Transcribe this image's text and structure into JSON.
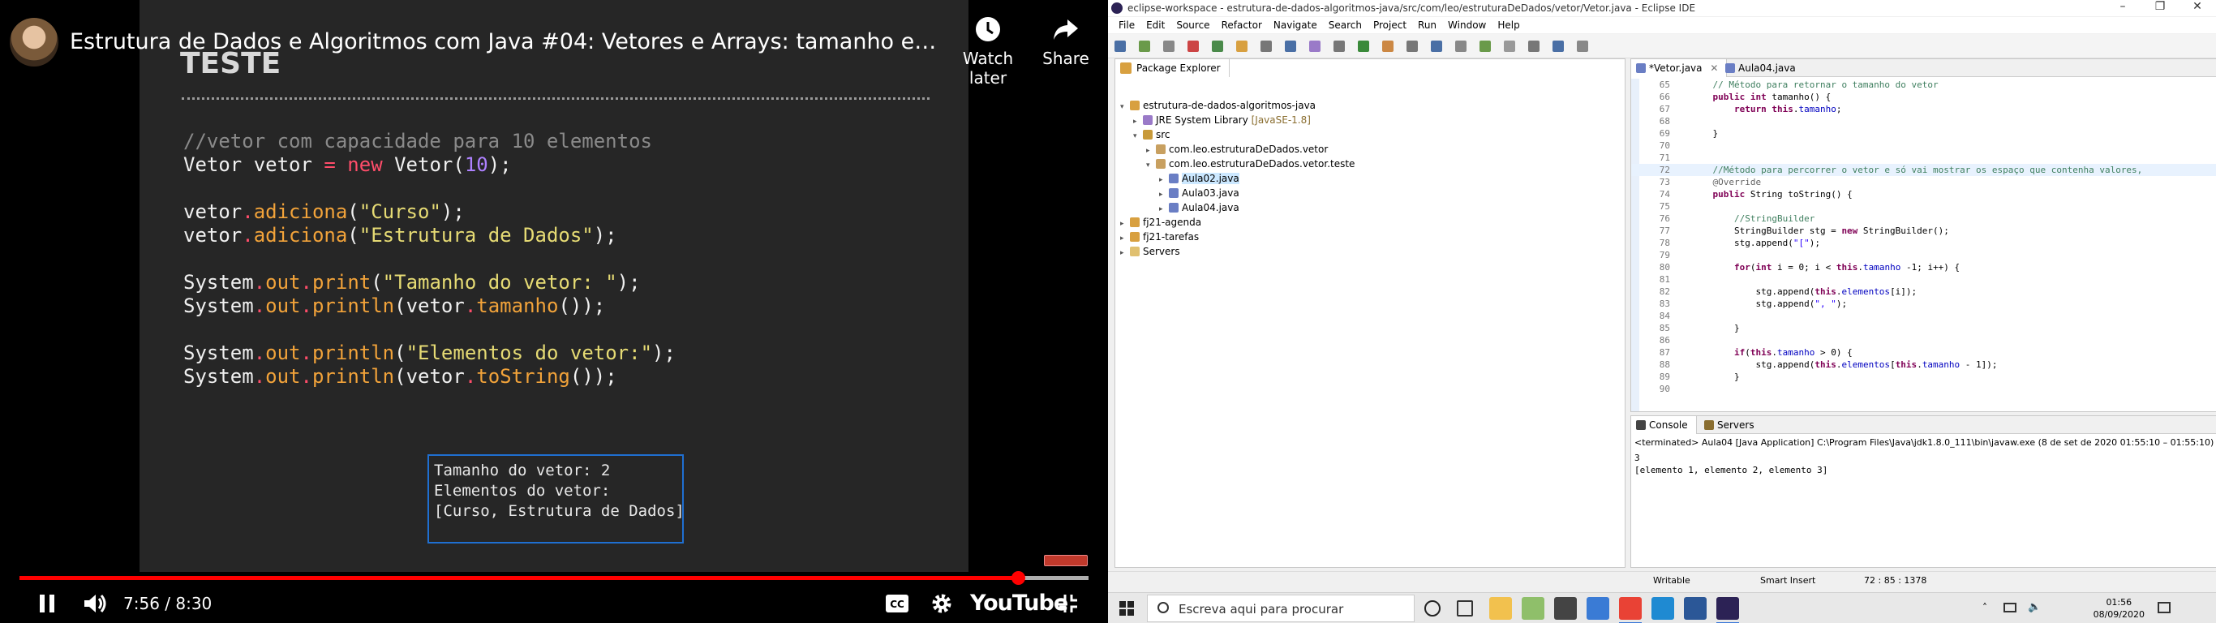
{
  "youtube": {
    "video_title": "Estrutura de Dados e Algoritmos com Java #04: Vetores e Arrays: tamanho e imprimir el…",
    "watch_later_label": "Watch later",
    "share_label": "Share",
    "slide": {
      "title": "TESTE",
      "code_lines": [
        [
          {
            "t": "//vetor com capacidade para 10 elementos",
            "c": "c-com"
          }
        ],
        [
          {
            "t": "Vetor vetor "
          },
          {
            "t": "=",
            "c": "c-op"
          },
          {
            "t": " "
          },
          {
            "t": "new",
            "c": "c-kw"
          },
          {
            "t": " Vetor("
          },
          {
            "t": "10",
            "c": "c-num"
          },
          {
            "t": ");"
          }
        ],
        [
          {
            "t": ""
          }
        ],
        [
          {
            "t": "vetor"
          },
          {
            "t": ".",
            "c": "c-op"
          },
          {
            "t": "adiciona",
            "c": "c-fn"
          },
          {
            "t": "("
          },
          {
            "t": "\"Curso\"",
            "c": "c-str"
          },
          {
            "t": ");"
          }
        ],
        [
          {
            "t": "vetor"
          },
          {
            "t": ".",
            "c": "c-op"
          },
          {
            "t": "adiciona",
            "c": "c-fn"
          },
          {
            "t": "("
          },
          {
            "t": "\"Estrutura de Dados\"",
            "c": "c-str"
          },
          {
            "t": ");"
          }
        ],
        [
          {
            "t": ""
          }
        ],
        [
          {
            "t": "System"
          },
          {
            "t": ".",
            "c": "c-op"
          },
          {
            "t": "out",
            "c": "c-fn"
          },
          {
            "t": ".",
            "c": "c-op"
          },
          {
            "t": "print",
            "c": "c-fn"
          },
          {
            "t": "("
          },
          {
            "t": "\"Tamanho do vetor: \"",
            "c": "c-str"
          },
          {
            "t": ");"
          }
        ],
        [
          {
            "t": "System"
          },
          {
            "t": ".",
            "c": "c-op"
          },
          {
            "t": "out",
            "c": "c-fn"
          },
          {
            "t": ".",
            "c": "c-op"
          },
          {
            "t": "println",
            "c": "c-fn"
          },
          {
            "t": "(vetor"
          },
          {
            "t": ".",
            "c": "c-op"
          },
          {
            "t": "tamanho",
            "c": "c-fn"
          },
          {
            "t": "());"
          }
        ],
        [
          {
            "t": ""
          }
        ],
        [
          {
            "t": "System"
          },
          {
            "t": ".",
            "c": "c-op"
          },
          {
            "t": "out",
            "c": "c-fn"
          },
          {
            "t": ".",
            "c": "c-op"
          },
          {
            "t": "println",
            "c": "c-fn"
          },
          {
            "t": "("
          },
          {
            "t": "\"Elementos do vetor:\"",
            "c": "c-str"
          },
          {
            "t": ");"
          }
        ],
        [
          {
            "t": "System"
          },
          {
            "t": ".",
            "c": "c-op"
          },
          {
            "t": "out",
            "c": "c-fn"
          },
          {
            "t": ".",
            "c": "c-op"
          },
          {
            "t": "println",
            "c": "c-fn"
          },
          {
            "t": "(vetor"
          },
          {
            "t": ".",
            "c": "c-op"
          },
          {
            "t": "toString",
            "c": "c-fn"
          },
          {
            "t": "());"
          }
        ]
      ],
      "output_lines": [
        "Tamanho do vetor: 2",
        "Elementos do vetor:",
        "[Curso, Estrutura de Dados]"
      ]
    },
    "time_current": "7:56",
    "time_total": "8:30",
    "time_display": "7:56 / 8:30",
    "progress_fraction": 0.934,
    "buffered_fraction": 1.0,
    "logo_text": "YouTube",
    "colors": {
      "progress": "#ff0000",
      "slide_bg": "#262626",
      "output_border": "#1f6fd1"
    }
  },
  "eclipse": {
    "window_title": "eclipse-workspace - estrutura-de-dados-algoritmos-java/src/com/leo/estruturaDeDados/vetor/Vetor.java - Eclipse IDE",
    "menu": [
      "File",
      "Edit",
      "Source",
      "Refactor",
      "Navigate",
      "Search",
      "Project",
      "Run",
      "Window",
      "Help"
    ],
    "package_explorer": {
      "tab_label": "Package Explorer",
      "tree": [
        {
          "label": "estrutura-de-dados-algoritmos-java",
          "depth": 0,
          "arrow": "▾",
          "icon": "project-icon",
          "color": "#d8a040"
        },
        {
          "label": "JRE System Library",
          "decor": " [JavaSE-1.8]",
          "depth": 1,
          "arrow": "▸",
          "icon": "library-icon",
          "color": "#9a7ac8"
        },
        {
          "label": "src",
          "depth": 1,
          "arrow": "▾",
          "icon": "source-folder-icon",
          "color": "#c89a3a"
        },
        {
          "label": "com.leo.estruturaDeDados.vetor",
          "depth": 2,
          "arrow": "▸",
          "icon": "package-icon",
          "color": "#c8a060"
        },
        {
          "label": "com.leo.estruturaDeDados.vetor.teste",
          "depth": 2,
          "arrow": "▾",
          "icon": "package-icon",
          "color": "#c8a060"
        },
        {
          "label": "Aula02.java",
          "depth": 3,
          "arrow": "▸",
          "icon": "java-file-icon",
          "color": "#6a7ec4",
          "selected": true
        },
        {
          "label": "Aula03.java",
          "depth": 3,
          "arrow": "▸",
          "icon": "java-file-icon",
          "color": "#6a7ec4"
        },
        {
          "label": "Aula04.java",
          "depth": 3,
          "arrow": "▸",
          "icon": "java-file-icon",
          "color": "#6a7ec4"
        },
        {
          "label": "fj21-agenda",
          "depth": 0,
          "arrow": "▸",
          "icon": "project-icon",
          "color": "#d8a040"
        },
        {
          "label": "fj21-tarefas",
          "depth": 0,
          "arrow": "▸",
          "icon": "project-icon",
          "color": "#d8a040"
        },
        {
          "label": "Servers",
          "depth": 0,
          "arrow": "▸",
          "icon": "folder-icon",
          "color": "#e0c070"
        }
      ]
    },
    "editor": {
      "tabs": [
        {
          "label": "*Vetor.java"
        },
        {
          "label": "Aula04.java"
        }
      ],
      "lines": [
        {
          "no": "65",
          "segs": [
            {
              "t": "    "
            },
            {
              "t": "// Método para retornar o tamanho do vetor",
              "c": "e-com"
            }
          ]
        },
        {
          "no": "66",
          "segs": [
            {
              "t": "    "
            },
            {
              "t": "public int",
              "c": "e-kw"
            },
            {
              "t": " tamanho() {"
            }
          ]
        },
        {
          "no": "67",
          "segs": [
            {
              "t": "        "
            },
            {
              "t": "return this",
              "c": "e-kw"
            },
            {
              "t": "."
            },
            {
              "t": "tamanho",
              "c": "e-fld"
            },
            {
              "t": ";"
            }
          ]
        },
        {
          "no": "68",
          "segs": [
            {
              "t": ""
            }
          ]
        },
        {
          "no": "69",
          "segs": [
            {
              "t": "    }"
            }
          ]
        },
        {
          "no": "70",
          "segs": [
            {
              "t": ""
            }
          ]
        },
        {
          "no": "71",
          "segs": [
            {
              "t": ""
            }
          ]
        },
        {
          "no": "72",
          "hl": true,
          "segs": [
            {
              "t": "    "
            },
            {
              "t": "//Método para percorrer o vetor e só vai mostrar os espaço que contenha valores,",
              "c": "e-com"
            }
          ]
        },
        {
          "no": "73",
          "segs": [
            {
              "t": "    "
            },
            {
              "t": "@Override",
              "c": "e-ann"
            }
          ]
        },
        {
          "no": "74",
          "segs": [
            {
              "t": "    "
            },
            {
              "t": "public",
              "c": "e-kw"
            },
            {
              "t": " String toString() {"
            }
          ]
        },
        {
          "no": "75",
          "segs": [
            {
              "t": ""
            }
          ]
        },
        {
          "no": "76",
          "segs": [
            {
              "t": "        "
            },
            {
              "t": "//StringBuilder",
              "c": "e-com"
            }
          ]
        },
        {
          "no": "77",
          "segs": [
            {
              "t": "        StringBuilder stg = "
            },
            {
              "t": "new",
              "c": "e-kw"
            },
            {
              "t": " StringBuilder();"
            }
          ]
        },
        {
          "no": "78",
          "segs": [
            {
              "t": "        stg.append("
            },
            {
              "t": "\"[\"",
              "c": "e-str"
            },
            {
              "t": ");"
            }
          ]
        },
        {
          "no": "79",
          "segs": [
            {
              "t": ""
            }
          ]
        },
        {
          "no": "80",
          "segs": [
            {
              "t": "        "
            },
            {
              "t": "for",
              "c": "e-kw"
            },
            {
              "t": "("
            },
            {
              "t": "int",
              "c": "e-kw"
            },
            {
              "t": " i = 0; i < "
            },
            {
              "t": "this",
              "c": "e-kw"
            },
            {
              "t": "."
            },
            {
              "t": "tamanho",
              "c": "e-fld"
            },
            {
              "t": " -1; i++) {"
            }
          ]
        },
        {
          "no": "81",
          "segs": [
            {
              "t": ""
            }
          ]
        },
        {
          "no": "82",
          "segs": [
            {
              "t": "            stg.append("
            },
            {
              "t": "this",
              "c": "e-kw"
            },
            {
              "t": "."
            },
            {
              "t": "elementos",
              "c": "e-fld"
            },
            {
              "t": "[i]);"
            }
          ]
        },
        {
          "no": "83",
          "segs": [
            {
              "t": "            stg.append("
            },
            {
              "t": "\", \"",
              "c": "e-str"
            },
            {
              "t": ");"
            }
          ]
        },
        {
          "no": "84",
          "segs": [
            {
              "t": ""
            }
          ]
        },
        {
          "no": "85",
          "segs": [
            {
              "t": "        }"
            }
          ]
        },
        {
          "no": "86",
          "segs": [
            {
              "t": ""
            }
          ]
        },
        {
          "no": "87",
          "segs": [
            {
              "t": "        "
            },
            {
              "t": "if",
              "c": "e-kw"
            },
            {
              "t": "("
            },
            {
              "t": "this",
              "c": "e-kw"
            },
            {
              "t": "."
            },
            {
              "t": "tamanho",
              "c": "e-fld"
            },
            {
              "t": " > 0) {"
            }
          ]
        },
        {
          "no": "88",
          "segs": [
            {
              "t": "            stg.append("
            },
            {
              "t": "this",
              "c": "e-kw"
            },
            {
              "t": "."
            },
            {
              "t": "elementos",
              "c": "e-fld"
            },
            {
              "t": "["
            },
            {
              "t": "this",
              "c": "e-kw"
            },
            {
              "t": "."
            },
            {
              "t": "tamanho",
              "c": "e-fld"
            },
            {
              "t": " - 1]);"
            }
          ]
        },
        {
          "no": "89",
          "segs": [
            {
              "t": "        }"
            }
          ]
        },
        {
          "no": "90",
          "segs": [
            {
              "t": ""
            }
          ]
        }
      ]
    },
    "console": {
      "tabs": [
        {
          "label": "Console"
        },
        {
          "label": "Servers"
        }
      ],
      "terminated_line": "<terminated> Aula04 [Java Application] C:\\Program Files\\Java\\jdk1.8.0_111\\bin\\javaw.exe  (8 de set de 2020 01:55:10 – 01:55:10)",
      "output": [
        "3",
        "[elemento 1, elemento 2, elemento 3]"
      ]
    },
    "status": {
      "writable": "Writable",
      "insert_mode": "Smart Insert",
      "position": "72 : 85 : 1378"
    }
  },
  "taskbar": {
    "search_placeholder": "Escreva aqui para procurar",
    "apps": [
      {
        "name": "cortana-icon",
        "color": "#222222"
      },
      {
        "name": "task-view-icon",
        "color": "#333333"
      },
      {
        "name": "file-explorer-icon",
        "color": "#f2c14e"
      },
      {
        "name": "sticky-notes-icon",
        "color": "#8fbf6a"
      },
      {
        "name": "calculator-icon",
        "color": "#444444"
      },
      {
        "name": "photos-icon",
        "color": "#3a7bd5"
      },
      {
        "name": "chrome-icon",
        "color": "#e94235",
        "active": true
      },
      {
        "name": "vscode-icon",
        "color": "#1f8ad2"
      },
      {
        "name": "word-icon",
        "color": "#2b5797"
      },
      {
        "name": "eclipse-icon",
        "color": "#2c2255",
        "active": true
      }
    ],
    "time": "01:56",
    "date": "08/09/2020"
  }
}
